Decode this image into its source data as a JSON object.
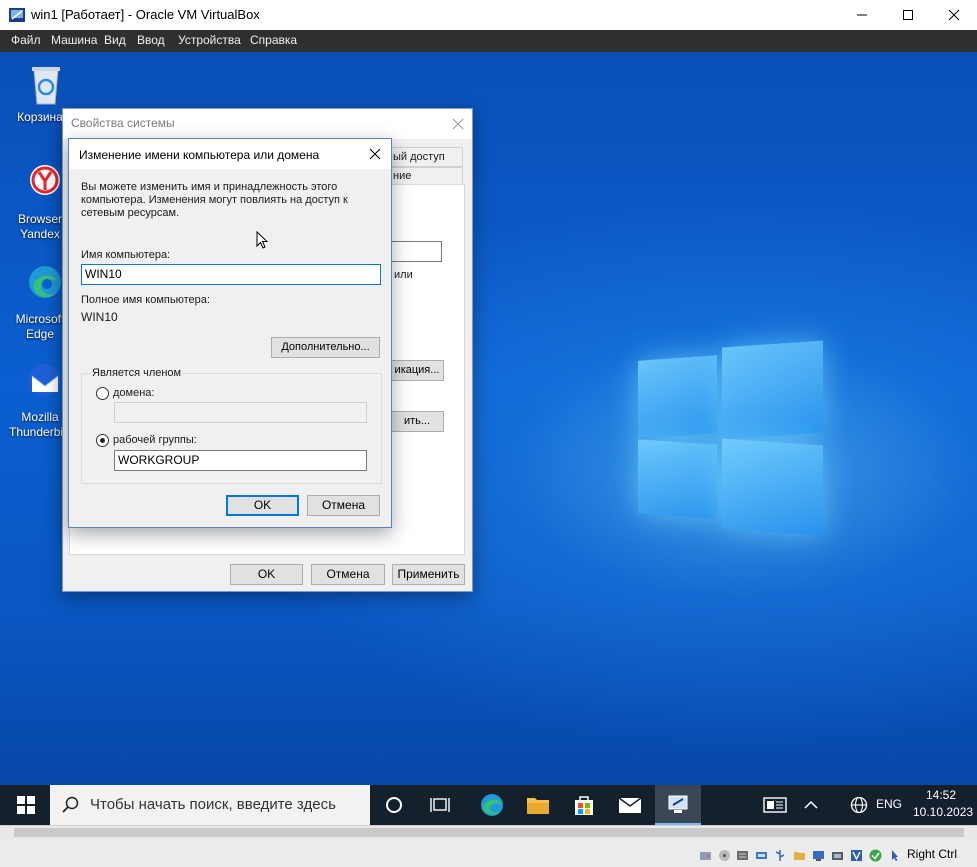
{
  "host": {
    "title": "win1 [Работает] - Oracle VM VirtualBox",
    "menu": [
      "Файл",
      "Машина",
      "Вид",
      "Ввод",
      "Устройства",
      "Справка"
    ]
  },
  "desktop": {
    "icons": [
      {
        "label_lines": [
          "Корзина"
        ],
        "icon": "recycle-bin-icon"
      },
      {
        "label_lines": [
          "Browser",
          "Yandex"
        ],
        "icon": "yandex-browser-icon"
      },
      {
        "label_lines": [
          "Microsoft",
          "Edge"
        ],
        "icon": "edge-icon"
      },
      {
        "label_lines": [
          "Mozilla",
          "Thunderbird"
        ],
        "icon": "thunderbird-icon"
      }
    ]
  },
  "sysprops": {
    "title": "Свойства системы",
    "tab_fragment_1": "ый доступ",
    "tab_fragment_2": "ние",
    "text_fragment": "или",
    "btn_fragment_1": "икация...",
    "btn_fragment_2": "ить...",
    "ok": "OK",
    "cancel": "Отмена",
    "apply": "Применить"
  },
  "rename": {
    "title": "Изменение имени компьютера или домена",
    "description": "Вы можете изменить имя и принадлежность этого компьютера. Изменения могут повлиять на доступ к сетевым ресурсам.",
    "computer_name_label": "Имя компьютера:",
    "computer_name_value": "WIN10",
    "full_name_label": "Полное имя компьютера:",
    "full_name_value": "WIN10",
    "more_button": "Дополнительно...",
    "member_of_label": "Является членом",
    "domain_label": "домена:",
    "domain_value": "",
    "workgroup_label": "рабочей группы:",
    "workgroup_value": "WORKGROUP",
    "selected": "workgroup",
    "ok": "OK",
    "cancel": "Отмена"
  },
  "taskbar": {
    "search_placeholder": "Чтобы начать поиск, введите здесь",
    "language": "ENG",
    "time": "14:52",
    "date": "10.10.2023"
  },
  "vbox_status": {
    "host_key": "Right Ctrl"
  }
}
